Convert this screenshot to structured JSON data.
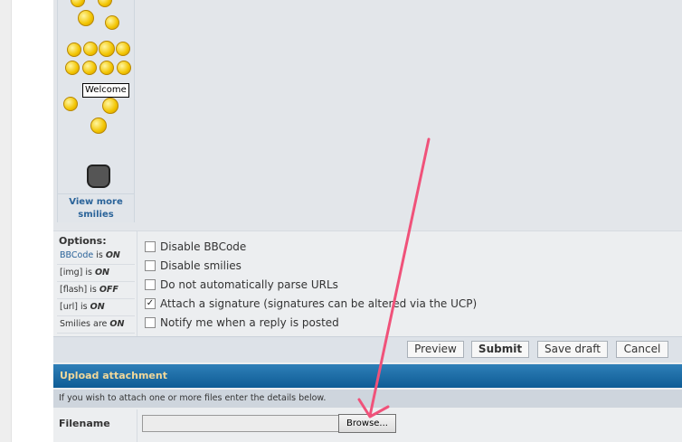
{
  "smilies": {
    "welcome_sign": "Welcome",
    "view_more": "View more smilies"
  },
  "options": {
    "title": "Options:",
    "status": [
      {
        "label": "BBCode",
        "suffix": " is ",
        "value": "ON",
        "link": true
      },
      {
        "label": "[img]",
        "suffix": " is ",
        "value": "ON",
        "link": false
      },
      {
        "label": "[flash]",
        "suffix": " is ",
        "value": "OFF",
        "link": false
      },
      {
        "label": "[url]",
        "suffix": " is ",
        "value": "ON",
        "link": false
      },
      {
        "label": "Smilies",
        "suffix": " are ",
        "value": "ON",
        "link": false
      }
    ],
    "checkboxes": [
      {
        "label": "Disable BBCode",
        "checked": false
      },
      {
        "label": "Disable smilies",
        "checked": false
      },
      {
        "label": "Do not automatically parse URLs",
        "checked": false
      },
      {
        "label": "Attach a signature (signatures can be altered via the UCP)",
        "checked": true
      },
      {
        "label": "Notify me when a reply is posted",
        "checked": false
      }
    ]
  },
  "buttons": {
    "preview": "Preview",
    "submit": "Submit",
    "save_draft": "Save draft",
    "cancel": "Cancel"
  },
  "upload": {
    "title": "Upload attachment",
    "info": "If you wish to attach one or more files enter the details below.",
    "filename_label": "Filename",
    "browse": "Browse..."
  },
  "colors": {
    "upload_header": "#1a6aa5",
    "annotation_arrow": "#f0527a"
  }
}
